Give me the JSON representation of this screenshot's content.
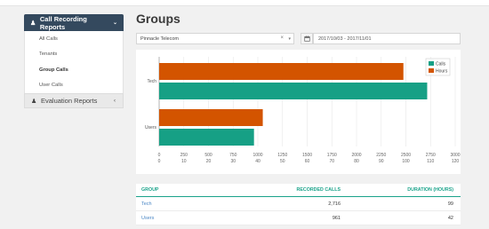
{
  "sidebar": {
    "section1": {
      "label": "Call Recording Reports",
      "icon": "user-icon",
      "chevron": "chevron-down-icon"
    },
    "items": [
      {
        "label": "All Calls"
      },
      {
        "label": "Tenants"
      },
      {
        "label": "Group Calls",
        "active": true
      },
      {
        "label": "User Calls"
      }
    ],
    "section2": {
      "label": "Evaluation Reports",
      "icon": "user-icon",
      "chevron": "chevron-left-icon"
    }
  },
  "main": {
    "title": "Groups",
    "tenant_select": {
      "value": "Pinnacle Telecom"
    },
    "date_range": {
      "value": "2017/10/03 - 2017/11/01"
    }
  },
  "chart_data": {
    "type": "bar",
    "orientation": "horizontal",
    "categories": [
      "Tech",
      "Users"
    ],
    "series": [
      {
        "name": "Hours",
        "values": [
          99,
          42
        ],
        "color": "#d35400",
        "axis": "bottom"
      },
      {
        "name": "Calls",
        "values": [
          2716,
          961
        ],
        "color": "#16a085",
        "axis": "top"
      }
    ],
    "calls_axis": {
      "min": 0,
      "max": 3000,
      "ticks": [
        "0",
        "250",
        "500",
        "750",
        "1000",
        "1250",
        "1500",
        "1750",
        "2000",
        "2250",
        "2500",
        "2750",
        "3000"
      ]
    },
    "hours_axis": {
      "min": 0,
      "max": 120,
      "ticks": [
        "0",
        "10",
        "20",
        "30",
        "40",
        "50",
        "60",
        "70",
        "80",
        "90",
        "100",
        "110",
        "120"
      ]
    },
    "legend": "top-right",
    "grid": true
  },
  "table": {
    "headers": [
      "GROUP",
      "RECORDED CALLS",
      "DURATION (HOURS)"
    ],
    "rows": [
      {
        "group": "Tech",
        "calls": "2,716",
        "hours": "99"
      },
      {
        "group": "Users",
        "calls": "961",
        "hours": "42"
      }
    ]
  }
}
